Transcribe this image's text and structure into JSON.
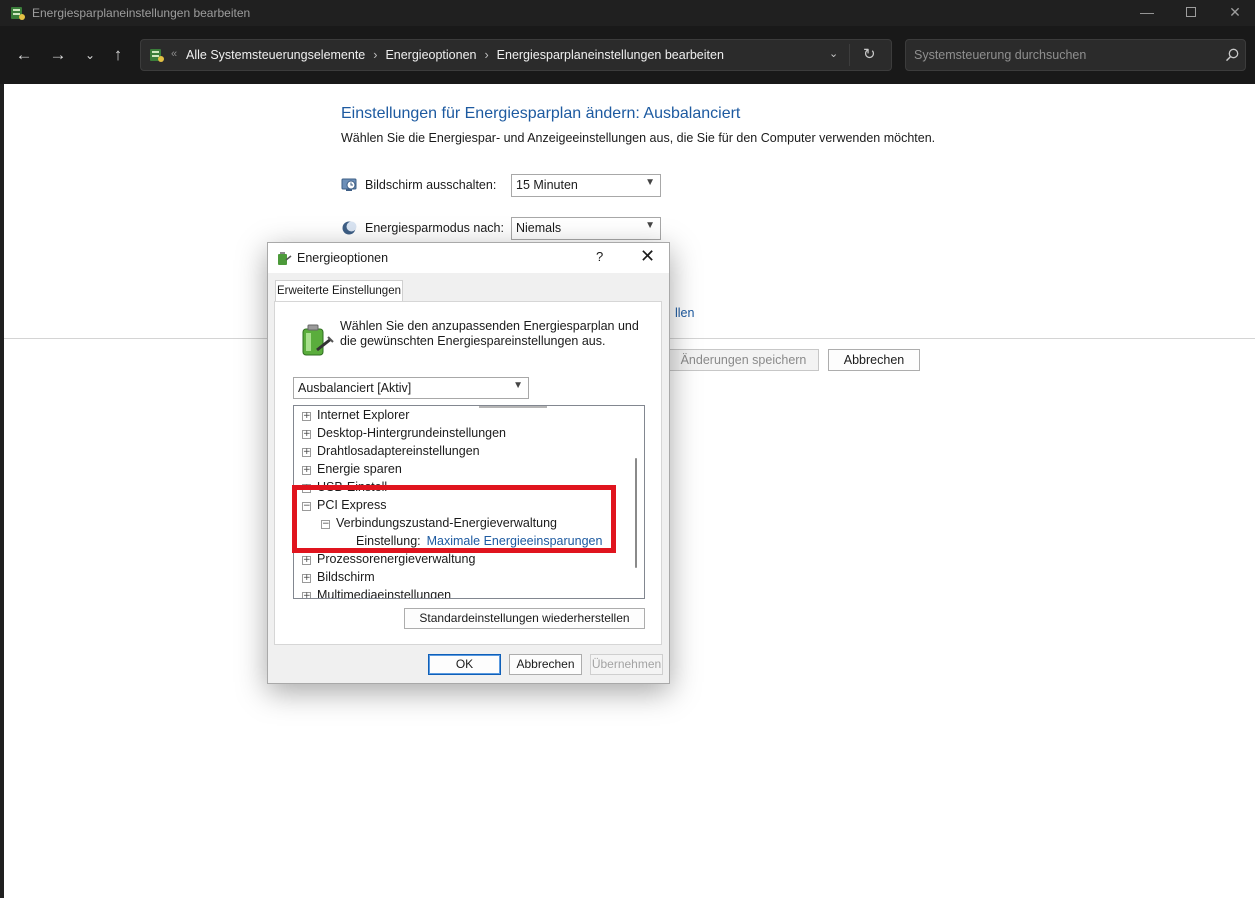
{
  "window": {
    "title": "Energiesparplaneinstellungen bearbeiten",
    "controls": {
      "minimize": "—",
      "close": "✕"
    }
  },
  "navbar": {
    "back": "←",
    "forward": "→",
    "recent": "⌄",
    "up": "↑",
    "address_prefix": "«",
    "breadcrumbs": [
      "Alle Systemsteuerungselemente",
      "Energieoptionen",
      "Energiesparplaneinstellungen bearbeiten"
    ],
    "breadcrumb_separator": "›",
    "dropdown": "⌄",
    "refresh": "↻",
    "search_placeholder": "Systemsteuerung durchsuchen"
  },
  "main": {
    "heading": "Einstellungen für Energiesparplan ändern: Ausbalanciert",
    "subheading": "Wählen Sie die Energiespar- und Anzeigeeinstellungen aus, die Sie für den Computer verwenden möchten.",
    "settings": [
      {
        "label": "Bildschirm ausschalten:",
        "value": "15 Minuten",
        "icon": "monitor-clock-icon"
      },
      {
        "label": "Energiesparmodus nach:",
        "value": "Niemals",
        "icon": "moon-icon"
      }
    ],
    "advanced_link_fragment": "llen",
    "save_button": "Änderungen speichern",
    "cancel_button": "Abbrechen"
  },
  "dialog": {
    "title": "Energieoptionen",
    "help": "?",
    "close": "✕",
    "tab": "Erweiterte Einstellungen",
    "intro": "Wählen Sie den anzupassenden Energiesparplan und die gewünschten Energiespareinstellungen aus.",
    "plan": "Ausbalanciert [Aktiv]",
    "tree": [
      {
        "label": "Internet Explorer",
        "sign": "+",
        "level": 0
      },
      {
        "label": "Desktop-Hintergrundeinstellungen",
        "sign": "+",
        "level": 0
      },
      {
        "label": "Drahtlosadaptereinstellungen",
        "sign": "+",
        "level": 0
      },
      {
        "label": "Energie sparen",
        "sign": "+",
        "level": 0
      },
      {
        "label": "USB-Einstell",
        "sign": "+",
        "level": 0
      },
      {
        "label": "PCI Express",
        "sign": "−",
        "level": 0
      },
      {
        "label": "Verbindungszustand-Energieverwaltung",
        "sign": "−",
        "level": 1
      },
      {
        "label": "Einstellung:",
        "value": "Maximale Energieeinsparungen",
        "level": 2
      },
      {
        "label": "Prozessorenergieverwaltung",
        "sign": "+",
        "level": 0
      },
      {
        "label": "Bildschirm",
        "sign": "+",
        "level": 0
      },
      {
        "label": "Multimediaeinstellungen",
        "sign": "+",
        "level": 0
      }
    ],
    "restore_button": "Standardeinstellungen wiederherstellen",
    "ok_button": "OK",
    "cancel_button": "Abbrechen",
    "apply_button": "Übernehmen"
  },
  "colors": {
    "highlight": "#e0141e",
    "link": "#1d5aa0",
    "chrome_bg": "#202020"
  }
}
